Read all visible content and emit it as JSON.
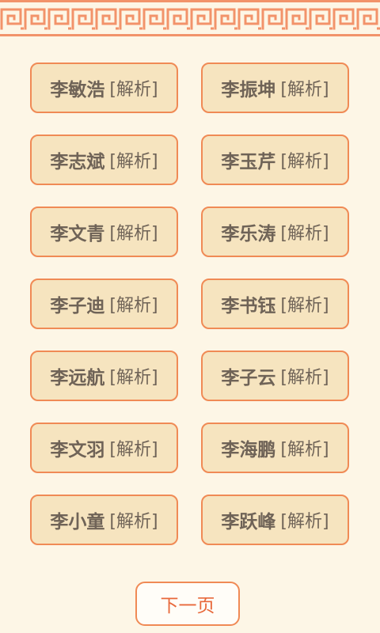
{
  "names": [
    {
      "name": "李敏浩",
      "tag": "[解析]"
    },
    {
      "name": "李振坤",
      "tag": "[解析]"
    },
    {
      "name": "李志斌",
      "tag": "[解析]"
    },
    {
      "name": "李玉芹",
      "tag": "[解析]"
    },
    {
      "name": "李文青",
      "tag": "[解析]"
    },
    {
      "name": "李乐涛",
      "tag": "[解析]"
    },
    {
      "name": "李子迪",
      "tag": "[解析]"
    },
    {
      "name": "李书钰",
      "tag": "[解析]"
    },
    {
      "name": "李远航",
      "tag": "[解析]"
    },
    {
      "name": "李子云",
      "tag": "[解析]"
    },
    {
      "name": "李文羽",
      "tag": "[解析]"
    },
    {
      "name": "李海鹏",
      "tag": "[解析]"
    },
    {
      "name": "李小童",
      "tag": "[解析]"
    },
    {
      "name": "李跃峰",
      "tag": "[解析]"
    }
  ],
  "next_label": "下一页",
  "colors": {
    "background": "#fdf6e6",
    "button_fill": "#f6e4bf",
    "button_border": "#f08a55",
    "text": "#6f6357",
    "accent": "#e8683a"
  }
}
